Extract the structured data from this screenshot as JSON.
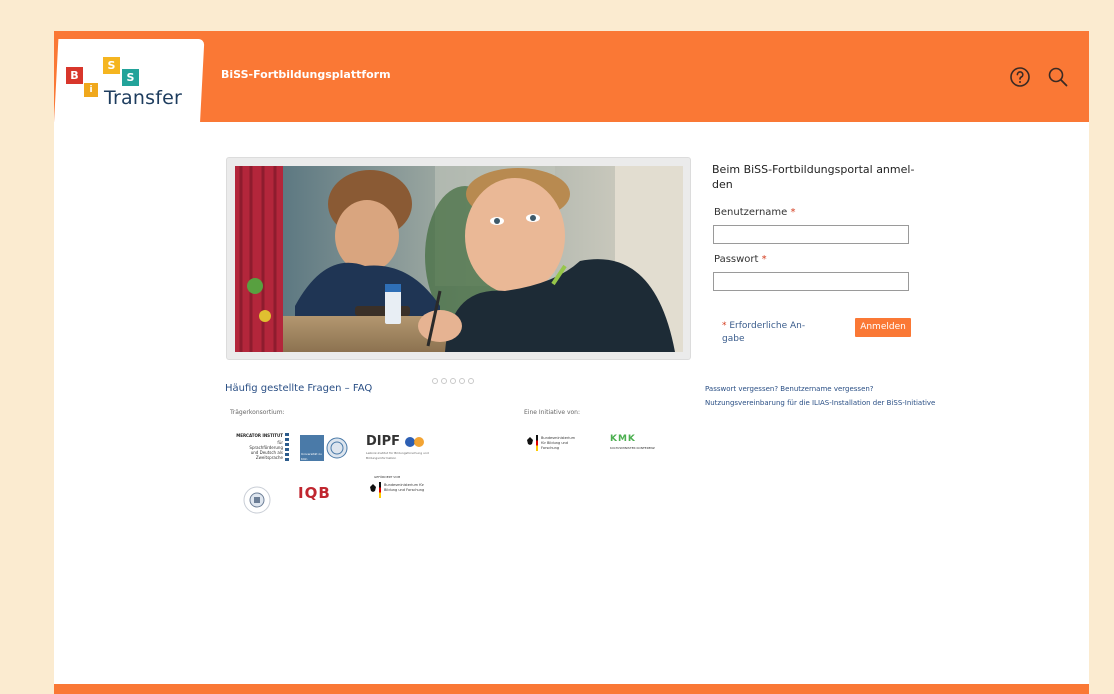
{
  "header": {
    "logo_text": "Transfer",
    "logo_tiles": [
      "B",
      "i",
      "S",
      "S"
    ],
    "platform_name": "BiSS-Fortbildungsplattform",
    "help_icon": "help-circle-icon",
    "search_icon": "search-icon"
  },
  "colors": {
    "accent": "#fa7835",
    "page_background": "#fbebd0",
    "link": "#2a4f85",
    "required": "#d43c1e"
  },
  "carousel": {
    "image": "photo of two schoolboys at a desk, one looking up holding a pen",
    "dot_count": 5
  },
  "login": {
    "title": "Beim BiSS-Fortbildungsportal anmel-den",
    "username_label": "Benutzername",
    "username_value": "",
    "password_label": "Passwort",
    "password_value": "",
    "required_marker": "*",
    "required_note": "Erforderliche An-gabe",
    "submit_label": "Anmelden"
  },
  "links": {
    "faq": "Häufig gestellte Fragen – FAQ",
    "forgot": "Passwort vergessen? Benutzername vergessen?",
    "terms": "Nutzungsvereinbarung für die ILIAS-Installation der BiSS-Initiative"
  },
  "partners": {
    "consortium_label": "Trägerkonsortium:",
    "initiative_label": "Eine Initiative von:",
    "mercator_title": "MERCATOR INSTITUT",
    "mercator_sub": "für Sprachförderung und Deutsch als Zweitsprache",
    "uni_koeln": "Universität zu Köln",
    "dipf_name": "DIPF",
    "dipf_sub": "Leibniz-Institut für Bildungsforschung und Bildungsinformation",
    "iqb_name": "IQB",
    "bmbf_text": "Bundesministerium für Bildung und Forschung",
    "bmbf_small_above": "GEFÖRDERT VOM",
    "kmk_name": "KMK",
    "kmk_sub": "KULTUSMINISTER KONFERENZ"
  }
}
